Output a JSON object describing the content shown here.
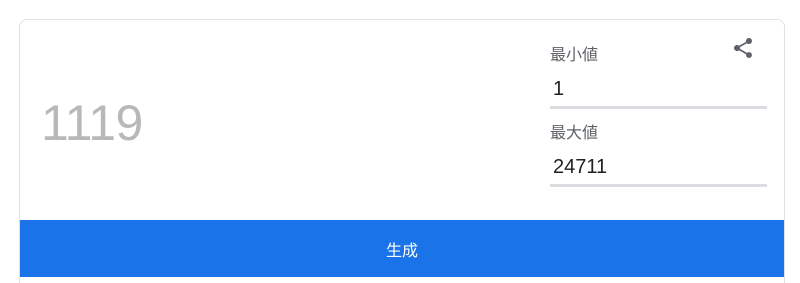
{
  "generator": {
    "result": "1119",
    "min": {
      "label": "最小値",
      "value": "1"
    },
    "max": {
      "label": "最大値",
      "value": "24711"
    },
    "generate_label": "生成",
    "share_icon": "share-icon"
  },
  "colors": {
    "accent": "#1a73e8",
    "result_text": "#b8b8b8",
    "label_text": "#5f6368",
    "underline": "#dadce0"
  }
}
